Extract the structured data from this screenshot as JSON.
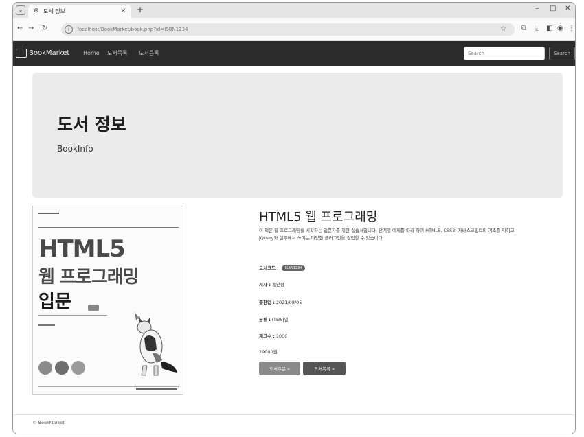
{
  "browser": {
    "tab_title": "도서 정보",
    "url": "localhost/BookMarket/book.php?id=ISBN1234",
    "win_min": "–",
    "win_max": "□",
    "win_close": "✕",
    "new_tab": "+",
    "tab_close": "×"
  },
  "navbar": {
    "brand": "BookMarket",
    "links": [
      "Home",
      "도서목록",
      "도서등록"
    ],
    "search_placeholder": "Search",
    "search_button": "Search"
  },
  "jumbotron": {
    "title": "도서 정보",
    "subtitle": "BookInfo"
  },
  "cover": {
    "title_line1": "HTML5",
    "title_line2": "웹 프로그래밍",
    "title_line3": "입문"
  },
  "book": {
    "title": "HTML5 웹 프로그래밍",
    "description": "이 책은 웹 프로그래밍을 시작하는 입문자를 위한 실습서입니다. 단계별 예제를 따라 하며 HTML5, CSS3, 자바스크립트의 기초를 익히고 jQuery와 실무에서 쓰이는 다양한 플러그인을 경험할 수 있습니다",
    "code_label": "도서코드 :",
    "code_value": "ISBN1234",
    "author_label": "저자 :",
    "author_value": "홍인성",
    "date_label": "출판일 :",
    "date_value": "2021/08/05",
    "category_label": "분류 :",
    "category_value": "IT모바일",
    "stock_label": "재고수 :",
    "stock_value": "1000",
    "price": "29000원",
    "order_button": "도서주문 »",
    "list_button": "도서목록 »"
  },
  "footer": {
    "text": "© BookMarket"
  }
}
